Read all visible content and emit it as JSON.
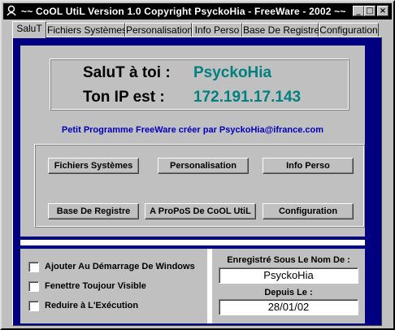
{
  "window": {
    "title": "~~ CoOL UtiL Version 1.0 Copyright PsyckoHia - FreeWare - 2002 ~~",
    "controls": {
      "minimize": "_",
      "maximize": "□",
      "close": "×"
    }
  },
  "tabs": [
    {
      "label": "SaluT"
    },
    {
      "label": "Fichiers Systèmes"
    },
    {
      "label": "Personalisation"
    },
    {
      "label": "Info Perso"
    },
    {
      "label": "Base De Registre"
    },
    {
      "label": "Configuration"
    }
  ],
  "greeting": {
    "hello_label": "SaluT à toi :",
    "hello_value": "PsyckoHia",
    "ip_label": "Ton IP est  :",
    "ip_value": "172.191.17.143"
  },
  "credit": "Petit Programme FreeWare créer par PsyckoHia@ifrance.com",
  "buttons": {
    "fichiers": "Fichiers Systèmes",
    "personalisation": "Personalisation",
    "info_perso": "Info Perso",
    "base_registre": "Base De Registre",
    "apropos": "A ProPoS De CoOL UtiL",
    "configuration": "Configuration"
  },
  "options": [
    {
      "label": "Ajouter Au Démarrage De Windows",
      "checked": false
    },
    {
      "label": "Fenettre Toujour Visible",
      "checked": false
    },
    {
      "label": "Reduire à L'Exécution",
      "checked": false
    }
  ],
  "registration": {
    "name_label": "Enregistré Sous Le Nom De :",
    "name_value": "PsyckoHia",
    "since_label": "Depuis Le :",
    "since_value": "28/01/02"
  },
  "colors": {
    "titlebar": "#000000",
    "panel_bg": "#000080",
    "accent_teal": "#008080",
    "credit_blue": "#0000c0"
  }
}
